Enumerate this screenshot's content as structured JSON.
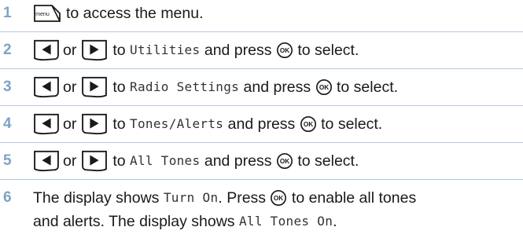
{
  "steps": [
    {
      "number": "1",
      "parts": {
        "t1": "to access the menu."
      }
    },
    {
      "number": "2",
      "parts": {
        "or": "or",
        "to": "to",
        "mono": "Utilities",
        "press": "and press",
        "select": "to select."
      }
    },
    {
      "number": "3",
      "parts": {
        "or": "or",
        "to": "to",
        "mono": "Radio Settings",
        "press": "and press",
        "select": "to select."
      }
    },
    {
      "number": "4",
      "parts": {
        "or": "or",
        "to": "to",
        "mono": "Tones/Alerts",
        "press": "and press",
        "select": "to select."
      }
    },
    {
      "number": "5",
      "parts": {
        "or": "or",
        "to": "to",
        "mono": "All Tones",
        "press": "and press",
        "select": "to select."
      }
    },
    {
      "number": "6",
      "parts": {
        "a": "The display shows",
        "m1": "Turn On",
        "b": ". Press",
        "c": "to enable all tones",
        "d": "and alerts. The display shows",
        "m2": "All Tones On",
        "e": "."
      }
    }
  ],
  "icons": {
    "menu_key": "menu-key-icon",
    "left_key": "left-arrow-key-icon",
    "right_key": "right-arrow-key-icon",
    "ok_key": "ok-button-icon",
    "menu_label": "menu",
    "ok_label": "OK"
  },
  "colors": {
    "step_number": "#7fa3c8",
    "rule": "#b6c9dd"
  }
}
